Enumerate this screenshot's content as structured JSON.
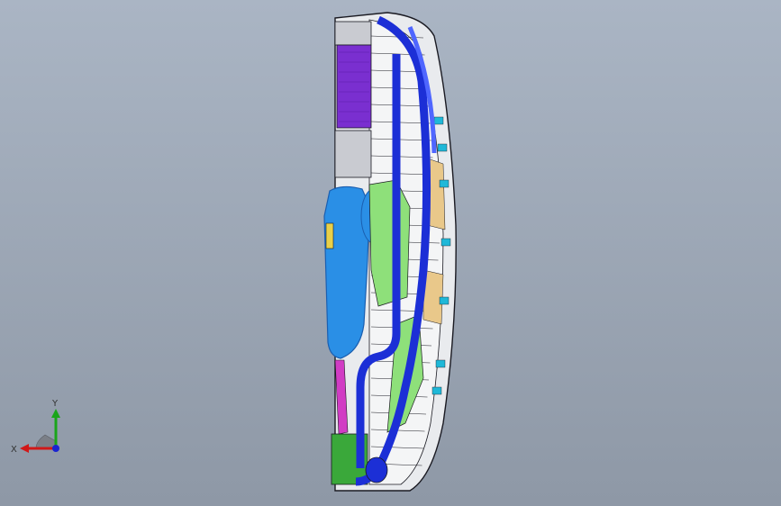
{
  "viewport": {
    "background_top": "#aab5c4",
    "background_bottom": "#8e98a6"
  },
  "model": {
    "colors": {
      "housing_outline": "#1a1a22",
      "housing_fill": "#e9ebee",
      "inner_panel": "#f4f5f6",
      "duct_blue": "#1c2fd6",
      "duct_highlight": "#4f66ff",
      "motor_blue": "#2a8fe6",
      "motor_dark": "#1b5fb0",
      "filter_purple": "#7a2fd0",
      "block_grey": "#c9cbd1",
      "pcb_green": "#3aa83a",
      "pcb_light_green": "#8ee07a",
      "pipe_magenta": "#d13cc4",
      "cyan_part": "#1fb8d8",
      "tan_part": "#e9c88a",
      "yellow_part": "#e8d04a"
    }
  },
  "triad": {
    "x_label": "X",
    "y_label": "Y",
    "x_color": "#d11818",
    "y_color": "#1aa51a",
    "z_color": "#1a24d1"
  }
}
